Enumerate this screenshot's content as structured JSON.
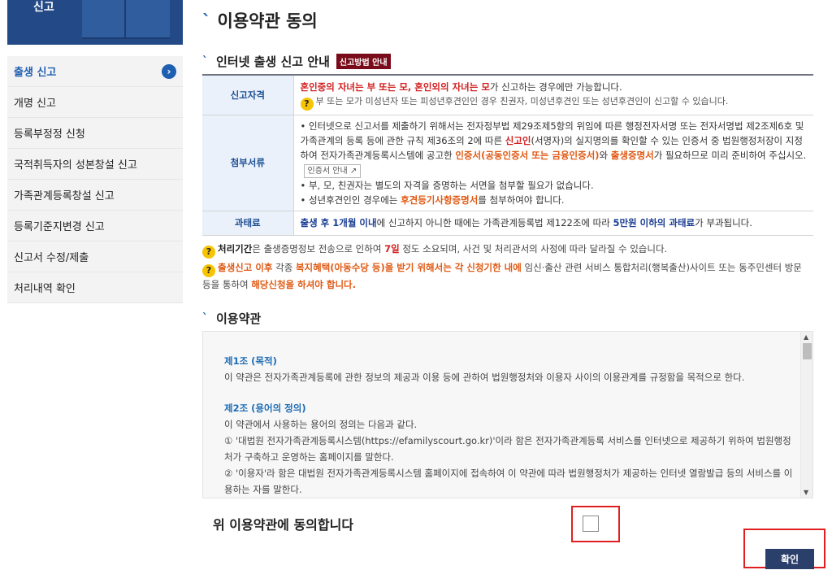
{
  "banner": {
    "text": "신고"
  },
  "sidebar": {
    "items": [
      {
        "label": "출생 신고",
        "active": true,
        "icon": "chevron-right-icon"
      },
      {
        "label": "개명 신고"
      },
      {
        "label": "등록부정정 신청"
      },
      {
        "label": "국적취득자의 성본창설 신고"
      },
      {
        "label": "가족관계등록창설 신고"
      },
      {
        "label": "등록기준지변경 신고"
      },
      {
        "label": "신고서 수정/제출"
      },
      {
        "label": "처리내역 확인"
      }
    ]
  },
  "page": {
    "title": "이용약관 동의"
  },
  "guide": {
    "title": "인터넷 출생 신고 안내",
    "badge": "신고방법 안내",
    "rows": {
      "eligibility": {
        "label": "신고자격",
        "red_text": "혼인중의 자녀는 부 또는 모, 혼인외의 자녀는 모",
        "text_after": "가 신고하는 경우에만 가능합니다.",
        "note": "부 또는 모가 미성년자 또는 피성년후견인인 경우 친권자, 미성년후견인 또는 성년후견인이 신고할 수 있습니다."
      },
      "documents": {
        "label": "첨부서류",
        "p1_a": "• 인터넷으로 신고서를 제출하기 위해서는 전자정부법 제29조제5항의 위임에 따른 행정전자서명 또는 전자서명법 제2조제6호 및 가족관계의 등록 등에 관한 규칙 제36조의 2에 따른 ",
        "p1_red": "신고인",
        "p1_b": "(서명자)의 실지명의를 확인할 수 있는 인증서 중 법원행정처장이 지정하여 전자가족관계등록시스템에 공고한 ",
        "p1_orange1": "인증서(공동인증서 또는 금융인증서)",
        "p1_c": "와 ",
        "p1_orange2": "출생증명서",
        "p1_d": "가 필요하므로 미리 준비하여 주십시오.",
        "cert_button": "인증서 안내",
        "p2": "• 부, 모, 친권자는 별도의 자격을 증명하는 서면을 첨부할 필요가 없습니다.",
        "p3_a": "• 성년후견인인 경우에는 ",
        "p3_orange": "후견등기사항증명서",
        "p3_b": "를 첨부하여야 합니다."
      },
      "penalty": {
        "label": "과태료",
        "blue1": "출생 후 1개월 이내",
        "text1": "에 신고하지 아니한 때에는 가족관계등록법 제122조에 따라 ",
        "blue2": "5만원 이하의 과태료",
        "text2": "가 부과됩니다."
      }
    }
  },
  "notes": {
    "n1_bold": "처리기간",
    "n1_a": "은 출생증명정보 전송으로 인하여 ",
    "n1_red": "7일",
    "n1_b": " 정도 소요되며, 사건 및 처리관서의 사정에 따라 달라질 수 있습니다.",
    "n2_orange1": "출생신고 이후",
    "n2_a": " 각종 ",
    "n2_orange2": "복지혜택(아동수당 등)을 받기 위해서는 각 신청기한 내에",
    "n2_b": " 임신·출산 관련 서비스 통합처리(행복출산)사이트 또는 동주민센터 방문 등을 통하여 ",
    "n2_orange3": "해당신청을 하셔야 합니다."
  },
  "terms": {
    "title": "이용약관",
    "art1_title": "제1조 (목적)",
    "art1_body": "이 약관은 전자가족관계등록에 관한 정보의 제공과 이용 등에 관하여 법원행정처와 이용자 사이의 이용관계를 규정함을 목적으로 한다.",
    "art2_title": "제2조 (용어의 정의)",
    "art2_intro": "이 약관에서 사용하는 용어의 정의는 다음과 같다.",
    "art2_item1": "① '대법원 전자가족관계등록시스템(https://efamilyscourt.go.kr)'이라 함은 전자가족관계등록 서비스를 인터넷으로 제공하기 위하여 법원행정처가 구축하고 운영하는 홈페이지를 말한다.",
    "art2_item2": "② '이용자'라 함은 대법원 전자가족관계등록시스템 홈페이지에 접속하여 이 약관에 따라 법원행정처가 제공하는 인터넷 열람발급 등의 서비스를 이용하는 자를 말한다."
  },
  "agree": {
    "label": "위 이용약관에 동의합니다",
    "checked": false
  },
  "confirm": {
    "label": "확인"
  },
  "colors": {
    "accent": "#1f5fb0",
    "badge": "#7a0b1a",
    "highlight": "#e02020",
    "confirm_bg": "#2b3f6b"
  }
}
